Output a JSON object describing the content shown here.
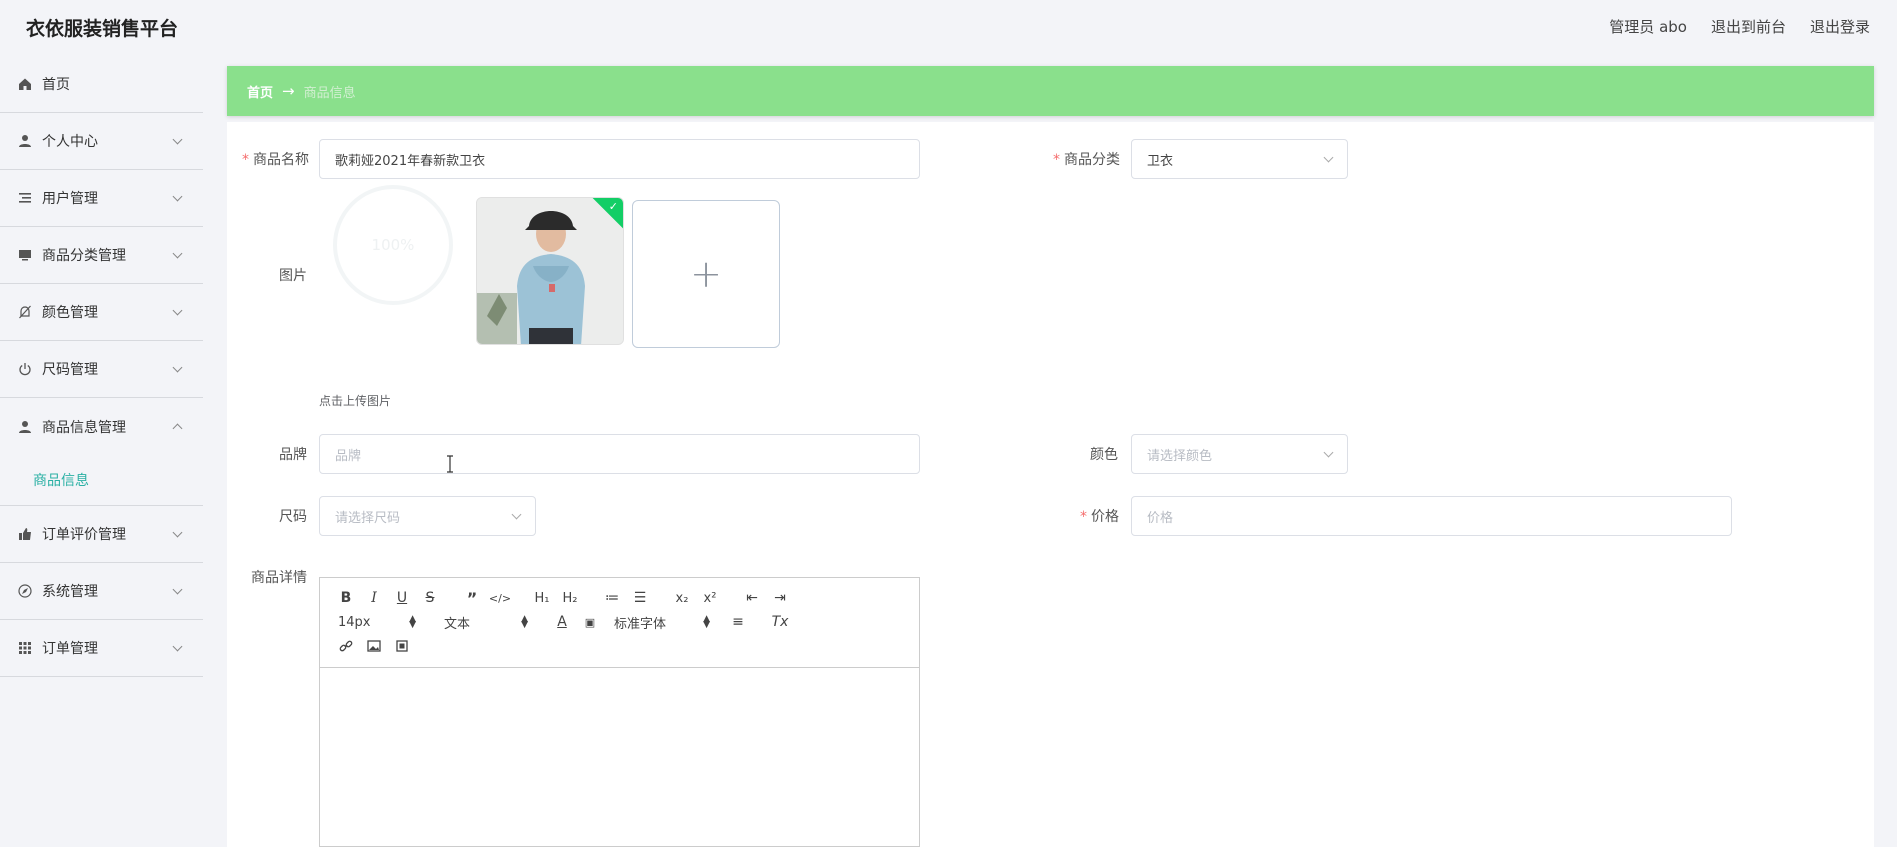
{
  "header": {
    "brand": "衣依服装销售平台",
    "admin_label": "管理员 abo",
    "to_front": "退出到前台",
    "logout": "退出登录"
  },
  "sidebar": {
    "items": [
      {
        "label": "首页",
        "icon": "home-icon"
      },
      {
        "label": "个人中心",
        "icon": "user-icon"
      },
      {
        "label": "用户管理",
        "icon": "list-icon"
      },
      {
        "label": "商品分类管理",
        "icon": "monitor-icon"
      },
      {
        "label": "颜色管理",
        "icon": "bell-off-icon"
      },
      {
        "label": "尺码管理",
        "icon": "power-icon"
      },
      {
        "label": "商品信息管理",
        "icon": "user-icon"
      },
      {
        "label": "订单评价管理",
        "icon": "thumb-up-icon"
      },
      {
        "label": "系统管理",
        "icon": "compass-icon"
      },
      {
        "label": "订单管理",
        "icon": "grid-icon"
      }
    ],
    "sub_item": "商品信息"
  },
  "breadcrumb": {
    "home": "首页",
    "arrow": "→",
    "current": "商品信息"
  },
  "form": {
    "name_label": "商品名称",
    "name_value": "歌莉娅2021年春新款卫衣",
    "category_label": "商品分类",
    "category_value": "卫衣",
    "image_label": "图片",
    "progress_text": "100%",
    "upload_plus": "+",
    "upload_tip": "点击上传图片",
    "brand_label": "品牌",
    "brand_placeholder": "品牌",
    "color_label": "颜色",
    "color_placeholder": "请选择颜色",
    "size_label": "尺码",
    "size_placeholder": "请选择尺码",
    "price_label": "价格",
    "price_placeholder": "价格",
    "detail_label": "商品详情",
    "required_mark": "*"
  },
  "editor": {
    "font_size": "14px",
    "header_select": "文本",
    "font_family": "标准字体"
  },
  "colors": {
    "accent_green": "#8ae08c",
    "active_teal": "#2ab0a4",
    "success": "#13ce66",
    "required": "#f56c6c"
  }
}
